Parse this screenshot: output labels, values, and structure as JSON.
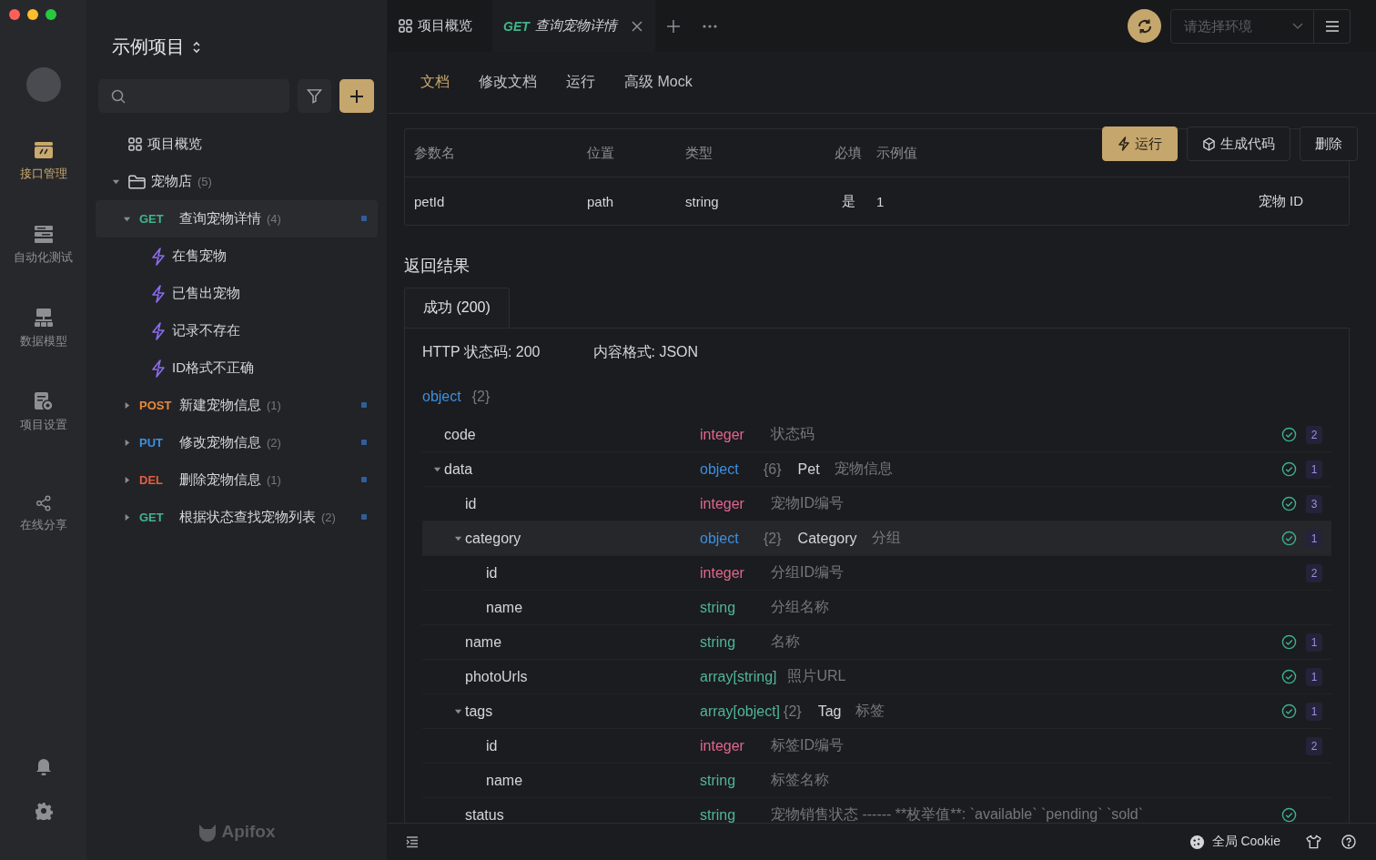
{
  "rail": {
    "items": [
      {
        "kind": "api",
        "label": "接口管理",
        "selected": true
      },
      {
        "kind": "tests",
        "label": "自动化测试",
        "selected": false
      },
      {
        "kind": "models",
        "label": "数据模型",
        "selected": false
      },
      {
        "kind": "settings",
        "label": "项目设置",
        "selected": false
      },
      {
        "kind": "share",
        "label": "在线分享",
        "selected": false
      }
    ]
  },
  "sidebar": {
    "title": "示例项目",
    "brand": "Apifox",
    "tree": [
      {
        "kind": "overview",
        "label": "项目概览"
      },
      {
        "kind": "folder",
        "label": "宠物店",
        "count": "(5)",
        "expanded": true,
        "children": [
          {
            "kind": "endpoint",
            "method": "GET",
            "color": "#3fb68b",
            "label": "查询宠物详情",
            "count": "(4)",
            "expanded": true,
            "selected": true,
            "children": [
              {
                "kind": "case",
                "label": "在售宠物"
              },
              {
                "kind": "case",
                "label": "已售出宠物"
              },
              {
                "kind": "case",
                "label": "记录不存在"
              },
              {
                "kind": "case",
                "label": "ID格式不正确"
              }
            ]
          },
          {
            "kind": "endpoint",
            "method": "POST",
            "color": "#e8893a",
            "label": "新建宠物信息",
            "count": "(1)",
            "expanded": false,
            "selected": false
          },
          {
            "kind": "endpoint",
            "method": "PUT",
            "color": "#3d8fe0",
            "label": "修改宠物信息",
            "count": "(2)",
            "expanded": false,
            "selected": false
          },
          {
            "kind": "endpoint",
            "method": "DEL",
            "color": "#e0603f",
            "label": "删除宠物信息",
            "count": "(1)",
            "expanded": false,
            "selected": false
          },
          {
            "kind": "endpoint",
            "method": "GET",
            "color": "#3fb68b",
            "label": "根据状态查找宠物列表",
            "count": "(2)",
            "expanded": false,
            "selected": false
          }
        ]
      }
    ]
  },
  "top_tabs": [
    {
      "kind": "overview",
      "label": "项目概览",
      "selected": false
    },
    {
      "kind": "request",
      "method": "GET",
      "color": "#3fb68b",
      "label": "查询宠物详情",
      "selected": true
    }
  ],
  "environment": {
    "placeholder": "请选择环境"
  },
  "doc_tabs": [
    {
      "label": "文档",
      "selected": true
    },
    {
      "label": "修改文档",
      "selected": false
    },
    {
      "label": "运行",
      "selected": false
    },
    {
      "label": "高级 Mock",
      "selected": false
    }
  ],
  "actions": [
    {
      "kind": "run",
      "label": "运行"
    },
    {
      "kind": "code",
      "label": "生成代码"
    },
    {
      "kind": "delete",
      "label": "删除"
    }
  ],
  "params": {
    "columns": [
      "参数名",
      "位置",
      "类型",
      "必填",
      "示例值"
    ],
    "rows": [
      {
        "name": "petId",
        "in": "path",
        "type": "string",
        "required": "是",
        "example": "1",
        "description": "宠物 ID"
      }
    ]
  },
  "response": {
    "title": "返回结果",
    "tabs": [
      {
        "label": "成功 (200)",
        "selected": true
      }
    ],
    "status": "HTTP 状态码: 200",
    "format": "内容格式: JSON",
    "root": {
      "type": "object",
      "count": "{2}"
    },
    "fields": [
      {
        "name": "code",
        "kind": "integer",
        "type": "integer",
        "description": "状态码",
        "required": true,
        "badge": "2"
      },
      {
        "name": "data",
        "kind": "object",
        "type": "object",
        "count": "{6}",
        "model": "Pet",
        "description": "宠物信息",
        "required": true,
        "badge": "1",
        "expanded": true,
        "children": [
          {
            "name": "id",
            "kind": "integer",
            "type": "integer",
            "description": "宠物ID编号",
            "required": true,
            "badge": "3"
          },
          {
            "name": "category",
            "kind": "object",
            "type": "object",
            "count": "{2}",
            "model": "Category",
            "description": "分组",
            "required": true,
            "badge": "1",
            "expanded": true,
            "selected": true,
            "children": [
              {
                "name": "id",
                "kind": "integer",
                "type": "integer",
                "description": "分组ID编号",
                "required": false,
                "badge": "2"
              },
              {
                "name": "name",
                "kind": "string",
                "type": "string",
                "description": "分组名称",
                "required": false
              }
            ]
          },
          {
            "name": "name",
            "kind": "string",
            "type": "string",
            "description": "名称",
            "required": true,
            "badge": "1"
          },
          {
            "name": "photoUrls",
            "kind": "array",
            "type": "array[string]",
            "description": "照片URL",
            "required": true,
            "badge": "1"
          },
          {
            "name": "tags",
            "kind": "array",
            "type": "array[object]",
            "count": "{2}",
            "model": "Tag",
            "description": "标签",
            "required": true,
            "badge": "1",
            "expanded": true,
            "children": [
              {
                "name": "id",
                "kind": "integer",
                "type": "integer",
                "description": "标签ID编号",
                "required": false,
                "badge": "2"
              },
              {
                "name": "name",
                "kind": "string",
                "type": "string",
                "description": "标签名称",
                "required": false
              }
            ]
          },
          {
            "name": "status",
            "kind": "string",
            "type": "string",
            "description": "宠物销售状态 ------ **枚举值**: `available` `pending` `sold`",
            "required": true
          }
        ]
      }
    ]
  },
  "footer": {
    "cookie": "全局 Cookie"
  }
}
